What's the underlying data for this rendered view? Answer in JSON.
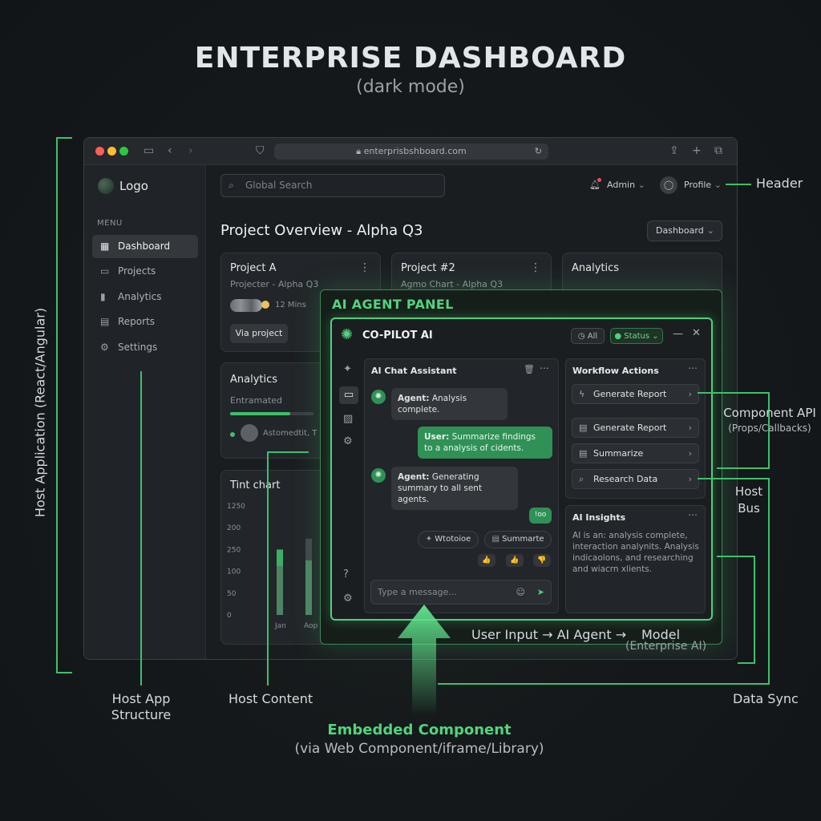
{
  "heading": {
    "title": "ENTERPRISE DASHBOARD",
    "subtitle": "(dark mode)"
  },
  "browser": {
    "url": "enterprisbshboard.com"
  },
  "sidebar": {
    "logo": "Logo",
    "menu_header": "MENU",
    "items": [
      {
        "label": "Dashboard",
        "icon": "grid-icon",
        "active": true
      },
      {
        "label": "Projects",
        "icon": "folder-icon"
      },
      {
        "label": "Analytics",
        "icon": "bar-chart-icon"
      },
      {
        "label": "Reports",
        "icon": "document-icon"
      },
      {
        "label": "Settings",
        "icon": "gear-icon"
      }
    ]
  },
  "header": {
    "search_placeholder": "Global Search",
    "admin": "Admin",
    "profile": "Profile"
  },
  "main": {
    "title": "Project Overview - Alpha Q3",
    "view_dropdown": "Dashboard",
    "card_a": {
      "title": "Project A",
      "sub": "Projecter - Alpha Q3",
      "time": "12 Mins",
      "button": "Via project"
    },
    "card_2": {
      "title": "Project #2",
      "sub": "Agmo Chart - Alpha Q3"
    },
    "card_analytics_top": {
      "title": "Analytics"
    },
    "card_analytics": {
      "title": "Analytics",
      "sub": "Entramated",
      "user": "Astomedtit, T",
      "progress": 0.72
    },
    "card_tint": {
      "title": "Tint chart"
    }
  },
  "chart_data": {
    "type": "bar",
    "title": "Tint chart",
    "y_ticks": [
      "1250",
      "200",
      "250",
      "100",
      "50",
      "0"
    ],
    "categories": [
      "Jan",
      "Aop"
    ],
    "series": [
      {
        "values": [
          60,
          50
        ],
        "color": "#3fbf6a"
      },
      {
        "values": [
          45,
          70
        ],
        "color": "#5d6166"
      }
    ]
  },
  "ai_panel": {
    "label": "AI AGENT PANEL",
    "app_name": "CO-PILOT AI",
    "all_badge": "All",
    "status": "Status",
    "chat": {
      "title": "AI Chat Assistant",
      "messages": [
        {
          "role": "agent",
          "prefix": "Agent:",
          "text": "Analysis complete."
        },
        {
          "role": "user",
          "prefix": "User:",
          "text": "Summarize findings to a analysis of cidents."
        },
        {
          "role": "agent",
          "prefix": "Agent:",
          "text": "Generating summary to all sent agents."
        }
      ],
      "small_reply": "!oo",
      "chips": [
        "Wtotoioe",
        "Summarte"
      ],
      "reactions": [
        "👍",
        "👍",
        "👎"
      ],
      "input_placeholder": "Type a message..."
    },
    "workflow": {
      "title": "Workflow Actions",
      "actions": [
        {
          "label": "Generate Report",
          "icon": "bolt-icon"
        },
        {
          "label": "Generate Report",
          "icon": "document-icon"
        },
        {
          "label": "Summarize",
          "icon": "document-icon"
        },
        {
          "label": "Research Data",
          "icon": "search-icon"
        }
      ]
    },
    "insights": {
      "title": "AI Insights",
      "text": "AI is an: analysis complete, interaction analynits.  Analysis indicaolons, and researching and wiacrn xlients."
    }
  },
  "annotations": {
    "host_application": "Host Application (React/Angular)",
    "header": "Header",
    "component_api": "Component API",
    "component_api_sub": "(Props/Callbacks)",
    "host_bus": "Host Bus",
    "host_app_structure": "Host App Structure",
    "host_content": "Host Content",
    "data_sync": "Data Sync",
    "flow": "User Input → AI Agent →",
    "model": "Model",
    "model_sub": "(Enterprise AI)",
    "embedded": "Embedded Component",
    "embedded_sub": "(via Web Component/iframe/Library)"
  }
}
